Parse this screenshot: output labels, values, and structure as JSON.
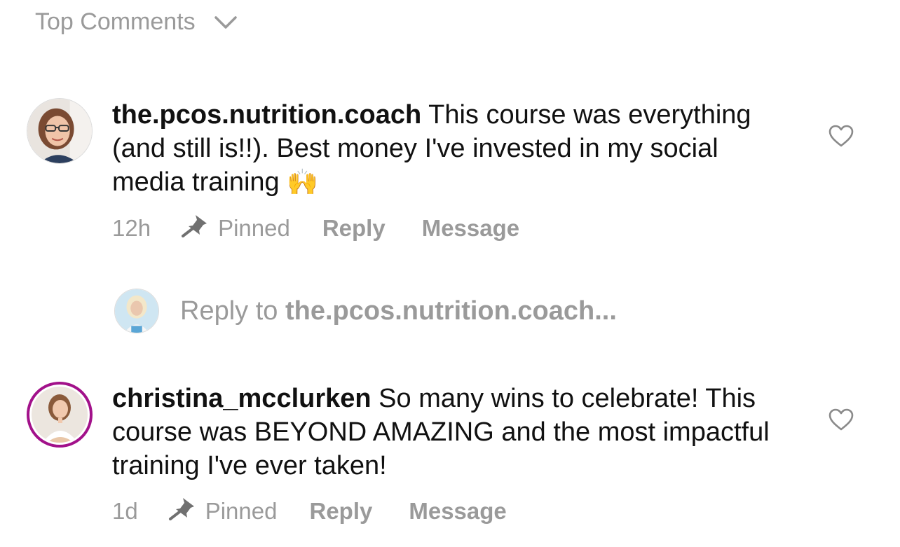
{
  "sort": {
    "label": "Top Comments"
  },
  "comments": [
    {
      "username": "the.pcos.nutrition.coach",
      "text": " This course was everything (and still is!!). Best money I've invested in my social media training ",
      "emoji": "🙌",
      "time": "12h",
      "pinned_label": "Pinned",
      "reply_label": "Reply",
      "message_label": "Message"
    },
    {
      "username": "christina_mcclurken",
      "text": " So many wins to celebrate! This course was BEYOND AMAZING and the most impactful training I've ever taken!",
      "time": "1d",
      "pinned_label": "Pinned",
      "reply_label": "Reply",
      "message_label": "Message"
    }
  ],
  "reply_box": {
    "prefix": "Reply to ",
    "target": "the.pcos.nutrition.coach..."
  },
  "icons": {
    "sort": "chevron-down-icon",
    "pin": "pin-icon",
    "like": "heart-outline-icon"
  },
  "colors": {
    "muted_text": "#9a9a9a",
    "story_ring": "#a2118a"
  }
}
